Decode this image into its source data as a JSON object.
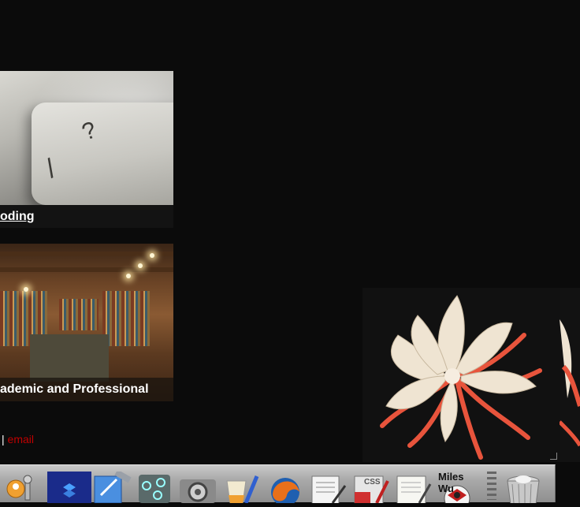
{
  "cards": [
    {
      "title": "oding"
    },
    {
      "title": "ademic and Professional"
    }
  ],
  "footer": {
    "separator": "|",
    "email_label": "email"
  },
  "dock": {
    "items": [
      {
        "name": "keychain-access-icon"
      },
      {
        "name": "dropbox-icon"
      },
      {
        "name": "xcode-icon"
      },
      {
        "name": "mindnode-icon"
      },
      {
        "name": "system-preferences-icon"
      },
      {
        "name": "coda-icon"
      },
      {
        "name": "firefox-icon"
      },
      {
        "name": "textedit-icon"
      },
      {
        "name": "css-edit-icon"
      },
      {
        "name": "document-icon"
      },
      {
        "name": "miles-wu-icon"
      },
      {
        "name": "trash-icon"
      }
    ],
    "miles_label": "Miles Wu",
    "css_label": "CSS"
  },
  "colors": {
    "background": "#0b0b0b",
    "link_red": "#c00000",
    "flower_petal": "#f0e6d6",
    "flower_stamen": "#e8543c"
  }
}
